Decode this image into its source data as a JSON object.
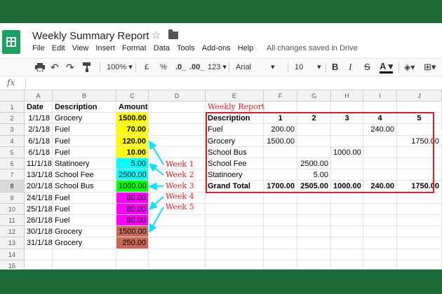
{
  "doc": {
    "title": "Weekly Summary Report",
    "save_status": "All changes saved in Drive"
  },
  "menu": [
    "File",
    "Edit",
    "View",
    "Insert",
    "Format",
    "Data",
    "Tools",
    "Add-ons",
    "Help"
  ],
  "toolbar": {
    "zoom": "100%",
    "currency": "£",
    "percent": "%",
    "dec_less": ".0_",
    "dec_more": ".00_",
    "more_formats": "123",
    "font": "Arial",
    "size": "10",
    "bold": "B",
    "italic": "I",
    "strike": "S",
    "text_color": "A"
  },
  "columns": [
    "A",
    "B",
    "C",
    "D",
    "E",
    "F",
    "G",
    "H",
    "I",
    "J"
  ],
  "rows": [
    "1",
    "2",
    "3",
    "4",
    "5",
    "6",
    "7",
    "8",
    "9",
    "10",
    "11",
    "12",
    "13",
    "14",
    "15"
  ],
  "headers": {
    "date": "Date",
    "description": "Description",
    "amount": "Amount"
  },
  "entries": [
    {
      "date": "1/1/18",
      "desc": "Grocery",
      "amount": "1500.00",
      "color": "#ffff00"
    },
    {
      "date": "2/1/18",
      "desc": "Fuel",
      "amount": "70.00",
      "color": "#ffff00"
    },
    {
      "date": "6/1/18",
      "desc": "Fuel",
      "amount": "120.00",
      "color": "#ffff00"
    },
    {
      "date": "6/1/18",
      "desc": "Fuel",
      "amount": "10.00",
      "color": "#ffff00"
    },
    {
      "date": "11/1/18",
      "desc": "Statinoery",
      "amount": "5.00",
      "color": "#00ffff"
    },
    {
      "date": "13/1/18",
      "desc": "School Fee",
      "amount": "2500.00",
      "color": "#00ffff"
    },
    {
      "date": "20/1/18",
      "desc": "School Bus",
      "amount": "1000.00",
      "color": "#00ff00"
    },
    {
      "date": "24/1/18",
      "desc": "Fuel",
      "amount": "80.00",
      "color": "#ff00ff"
    },
    {
      "date": "25/1/18",
      "desc": "Fuel",
      "amount": "80.00",
      "color": "#ff00ff"
    },
    {
      "date": "26/1/18",
      "desc": "Fuel",
      "amount": "80.00",
      "color": "#ff00ff"
    },
    {
      "date": "30/1/18",
      "desc": "Grocery",
      "amount": "1500.00",
      "color": "#cc6655"
    },
    {
      "date": "31/1/18",
      "desc": "Grocery",
      "amount": "250.00",
      "color": "#cc6655"
    }
  ],
  "week_labels": [
    "Week 1",
    "Week 2",
    "Week 3",
    "Week 4",
    "Week 5"
  ],
  "report": {
    "title": "Weekly Report",
    "header": [
      "Description",
      "1",
      "2",
      "3",
      "4",
      "5"
    ],
    "rows": [
      [
        "Fuel",
        "200.00",
        "",
        "",
        "240.00",
        ""
      ],
      [
        "Grocery",
        "1500.00",
        "",
        "",
        "",
        "1750.00"
      ],
      [
        "School Bus",
        "",
        "",
        "1000.00",
        "",
        ""
      ],
      [
        "School Fee",
        "",
        "2500.00",
        "",
        "",
        ""
      ],
      [
        "Statinoery",
        "",
        "5.00",
        "",
        "",
        ""
      ]
    ],
    "total": [
      "Grand Total",
      "1700.00",
      "2505.00",
      "1000.00",
      "240.00",
      "1750.00"
    ]
  },
  "accent_colors": {
    "arrow": "#00e5ff",
    "annotation": "#e01b24",
    "brand": "#1e6b3a"
  }
}
